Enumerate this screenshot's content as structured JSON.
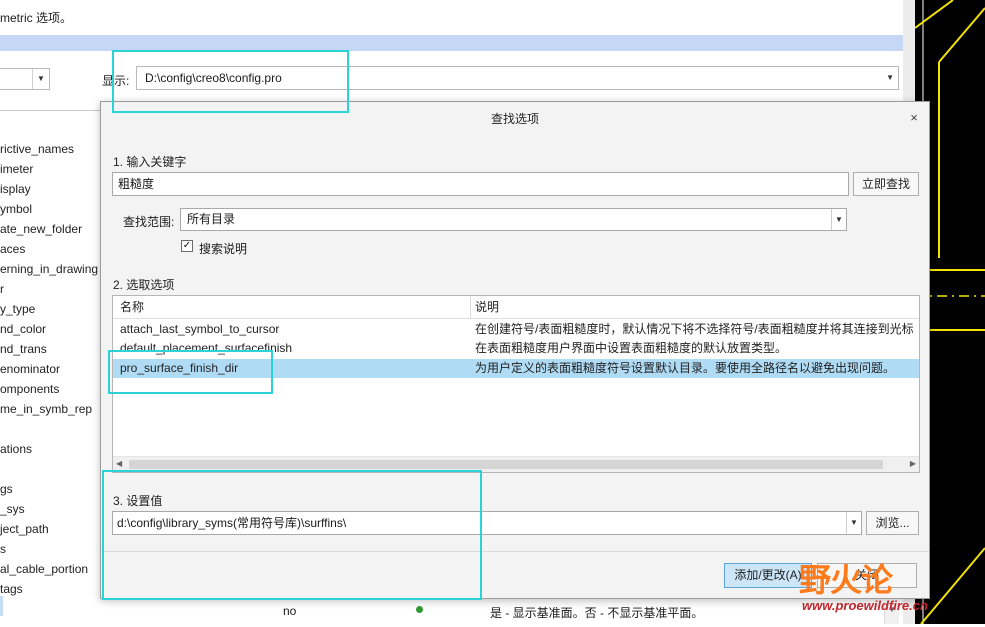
{
  "background_window": {
    "top_text": "metric 选项。",
    "show_label": "显示:",
    "show_value": "D:\\config\\creo8\\config.pro",
    "option_list": [
      "rictive_names",
      "imeter",
      "isplay",
      "ymbol",
      "ate_new_folder",
      "aces",
      "erning_in_drawing",
      "r",
      "y_type",
      "nd_color",
      "nd_trans",
      "enominator",
      "omponents",
      "me_in_symb_rep",
      "",
      "ations",
      "",
      "gs",
      "_sys",
      "ject_path",
      "s",
      "al_cable_portion",
      "tags"
    ],
    "bottom_row": {
      "value": "no",
      "description": "是 - 显示基准面。否 - 不显示基准平面。"
    }
  },
  "dialog": {
    "title": "查找选项",
    "close_glyph": "×",
    "step1_label": "1.  输入关键字",
    "keyword_value": "粗糙度",
    "find_now_button": "立即查找",
    "scope_label": "查找范围:",
    "scope_value": "所有目录",
    "search_desc_checked": true,
    "search_desc_label": "搜索说明",
    "step2_label": "2.  选取选项",
    "table": {
      "columns": [
        "名称",
        "说明"
      ],
      "rows": [
        {
          "name": "attach_last_symbol_to_cursor",
          "desc": "在创建符号/表面粗糙度时，默认情况下将不选择符号/表面粗糙度并将其连接到光标",
          "selected": false
        },
        {
          "name": "default_placement_surfacefinish",
          "desc": "在表面粗糙度用户界面中设置表面粗糙度的默认放置类型。",
          "selected": false
        },
        {
          "name": "pro_surface_finish_dir",
          "desc": "为用户定义的表面粗糙度符号设置默认目录。要使用全路径名以避免出现问题。",
          "selected": true
        }
      ]
    },
    "step3_label": "3.  设置值",
    "setting_value": "d:\\config\\library_syms(常用符号库)\\surffins\\",
    "browse_button": "浏览...",
    "add_change_button": "添加/更改(A)",
    "close_button": "关闭"
  },
  "watermark": {
    "logo": "野火论",
    "url": "www.proewildfire.cn"
  },
  "colors": {
    "callout": "#2bd3d8",
    "selection": "#b0dbf5",
    "primary_button": "#cce6f8",
    "cad_background": "#000000",
    "cad_lines": "#f2e300"
  }
}
